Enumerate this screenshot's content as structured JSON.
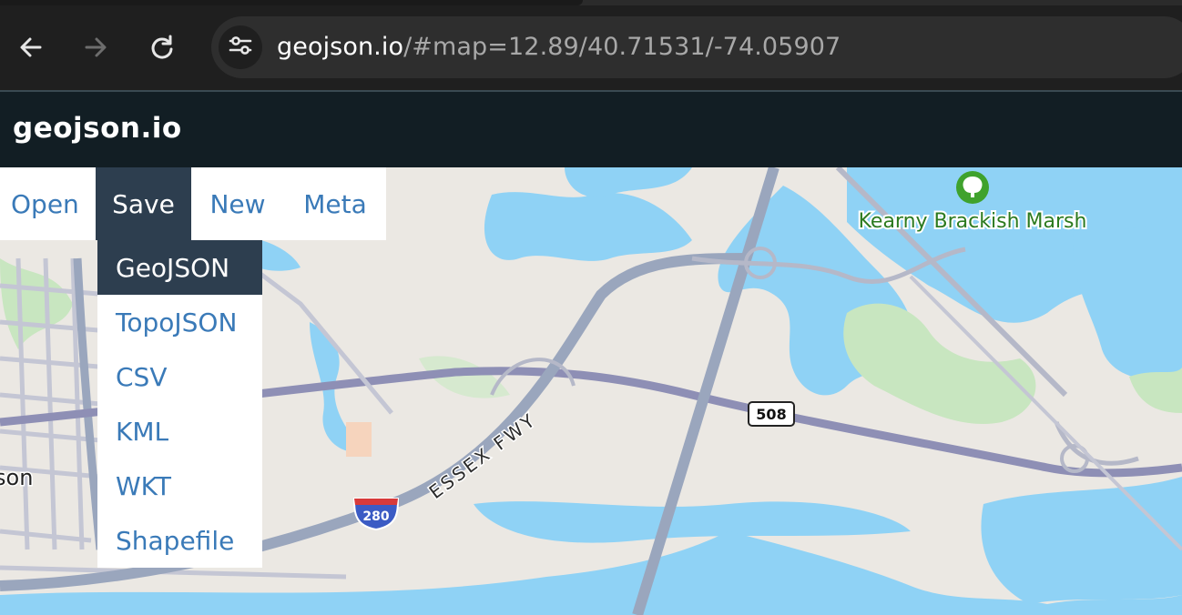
{
  "browser": {
    "url_host": "geojson.io",
    "url_rest": "/#map=12.89/40.71531/-74.05907",
    "icons": [
      "back-arrow-icon",
      "forward-arrow-icon",
      "reload-icon",
      "site-settings-icon"
    ]
  },
  "app": {
    "title": "geojson.io"
  },
  "menu": {
    "open": "Open",
    "save": "Save",
    "new": "New",
    "meta": "Meta",
    "save_options": [
      "GeoJSON",
      "TopoJSON",
      "CSV",
      "KML",
      "WKT",
      "Shapefile"
    ]
  },
  "map": {
    "park_label": "Kearny Brackish Marsh",
    "road_label": "ESSEX FWY",
    "route_508": "508",
    "interstate_280": "280",
    "city_fragment": "son",
    "colors": {
      "water": "#8fd2f5",
      "land": "#ece9e4",
      "park": "#c8e6c0",
      "road": "#9aa6bd",
      "highway": "#8e8fb5"
    }
  }
}
